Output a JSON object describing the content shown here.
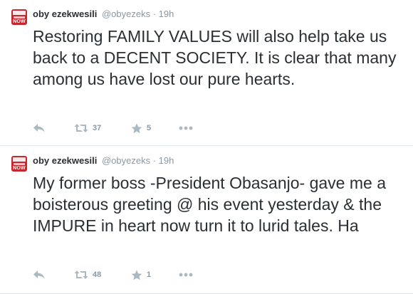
{
  "tweets": [
    {
      "avatar_word": "NOW",
      "fullname": "oby ezekwesili",
      "username": "@obyezeks",
      "separator": "·",
      "time": "19h",
      "text": "Restoring FAMILY VALUES will also help take us back to a DECENT SOCIETY. It is clear that many among us have lost our pure hearts.",
      "retweets": "37",
      "favorites": "5"
    },
    {
      "avatar_word": "NOW",
      "fullname": "oby ezekwesili",
      "username": "@obyezeks",
      "separator": "·",
      "time": "19h",
      "text": "My former boss -President Obasanjo- gave me a boisterous greeting @ his event yesterday & the IMPURE in heart now turn it to lurid tales. Ha",
      "retweets": "48",
      "favorites": "1"
    }
  ],
  "icons": {
    "reply": "reply-icon",
    "retweet": "retweet-icon",
    "favorite": "star-icon",
    "more": "more-icon"
  },
  "colors": {
    "avatar_red": "#c9252c",
    "text": "#292f33",
    "muted": "#8899a6",
    "icon": "#aab8c2",
    "divider": "#e1e8ed"
  }
}
